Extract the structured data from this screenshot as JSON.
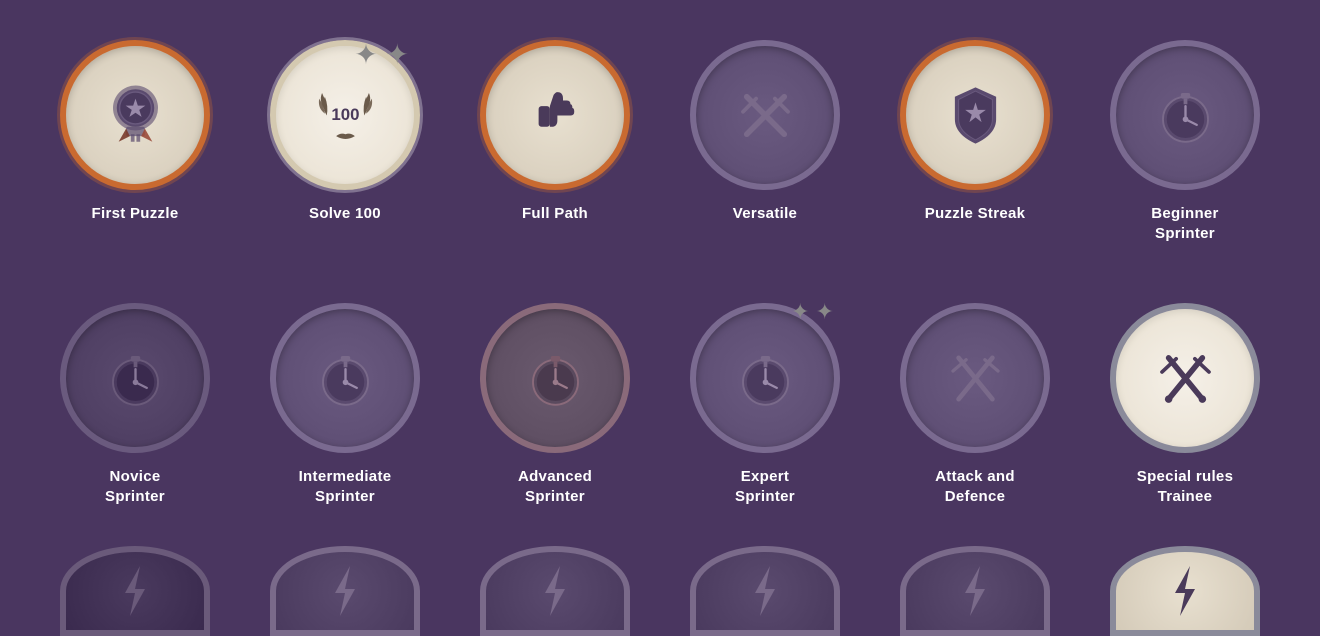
{
  "badges": {
    "row1": [
      {
        "id": "first-puzzle",
        "label": "First Puzzle",
        "style": "active-orange",
        "icon": "medal",
        "unlocked": true
      },
      {
        "id": "solve-100",
        "label": "Solve 100",
        "style": "active-white",
        "icon": "laurel-100",
        "unlocked": true,
        "sparkles": true
      },
      {
        "id": "full-path",
        "label": "Full Path",
        "style": "active-orange",
        "icon": "thumbsup",
        "unlocked": true
      },
      {
        "id": "versatile",
        "label": "Versatile",
        "style": "locked",
        "icon": "swords",
        "unlocked": false
      },
      {
        "id": "puzzle-streak",
        "label": "Puzzle Streak",
        "style": "active-orange",
        "icon": "shield-star",
        "unlocked": true
      },
      {
        "id": "beginner-sprinter",
        "label": "Beginner\nSprinter",
        "labelLines": [
          "Beginner",
          "Sprinter"
        ],
        "style": "locked",
        "icon": "timer",
        "unlocked": false
      }
    ],
    "row2": [
      {
        "id": "novice-sprinter",
        "label": "Novice\nSprinter",
        "labelLines": [
          "Novice",
          "Sprinter"
        ],
        "style": "locked-dark",
        "icon": "timer",
        "unlocked": false
      },
      {
        "id": "intermediate-sprinter",
        "label": "Intermediate\nSprinter",
        "labelLines": [
          "Intermediate",
          "Sprinter"
        ],
        "style": "locked",
        "icon": "timer",
        "unlocked": false
      },
      {
        "id": "advanced-sprinter",
        "label": "Advanced\nSprinter",
        "labelLines": [
          "Advanced",
          "Sprinter"
        ],
        "style": "locked-brown",
        "icon": "timer",
        "unlocked": false
      },
      {
        "id": "expert-sprinter",
        "label": "Expert\nSprinter",
        "labelLines": [
          "Expert",
          "Sprinter"
        ],
        "style": "locked",
        "icon": "timer",
        "unlocked": false,
        "sparkles": true
      },
      {
        "id": "attack-defence",
        "label": "Attack and\nDefence",
        "labelLines": [
          "Attack and",
          "Defence"
        ],
        "style": "locked",
        "icon": "swords-shield",
        "unlocked": false
      },
      {
        "id": "special-rules",
        "label": "Special rules\nTrainee",
        "labelLines": [
          "Special rules",
          "Trainee"
        ],
        "style": "active-white-sword",
        "icon": "sword-crossed",
        "unlocked": true
      }
    ],
    "row3": [
      {
        "style": "locked-dark",
        "icon": "bolt"
      },
      {
        "style": "locked",
        "icon": "bolt"
      },
      {
        "style": "locked",
        "icon": "bolt"
      },
      {
        "style": "locked",
        "icon": "bolt"
      },
      {
        "style": "locked",
        "icon": "bolt"
      },
      {
        "style": "locked-dark",
        "icon": "bolt"
      }
    ]
  }
}
